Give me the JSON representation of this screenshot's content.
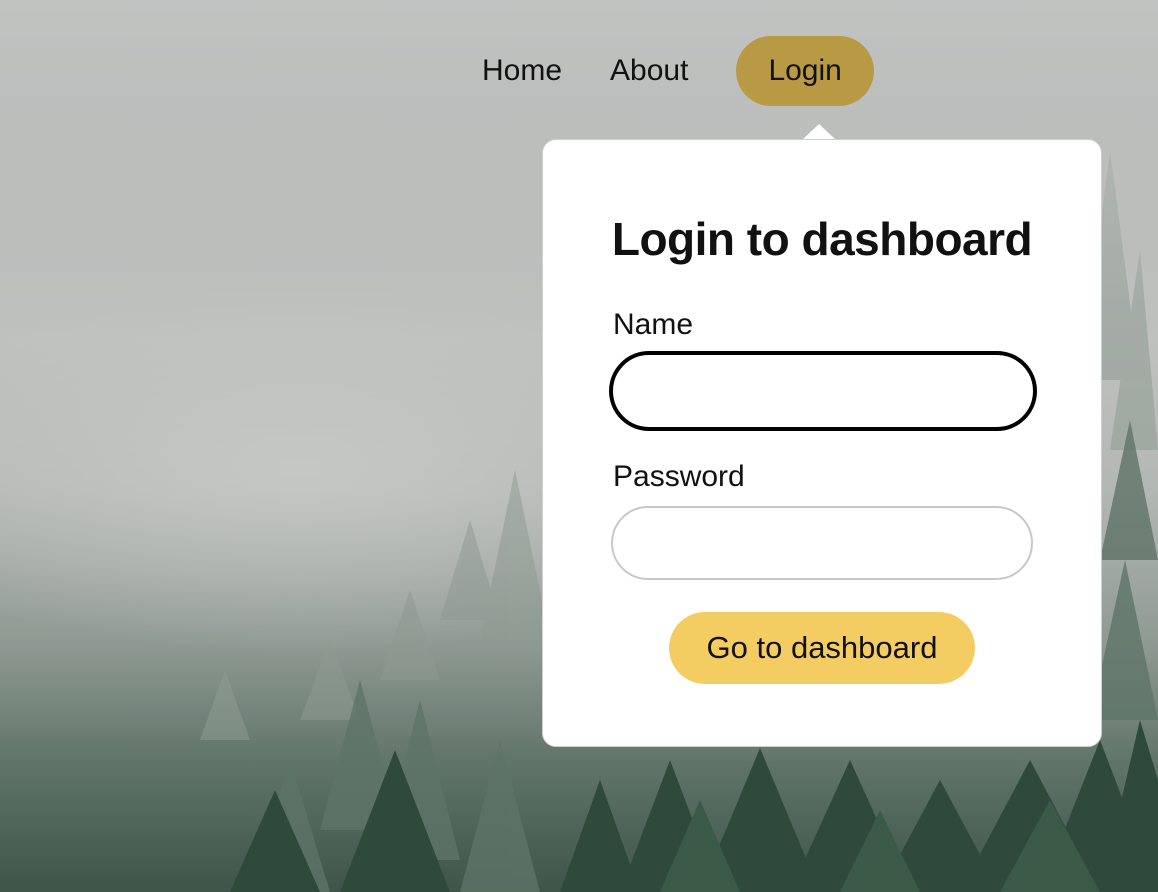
{
  "nav": {
    "home_label": "Home",
    "about_label": "About",
    "login_label": "Login"
  },
  "login_form": {
    "title": "Login to dashboard",
    "name_label": "Name",
    "name_value": "",
    "password_label": "Password",
    "password_value": "",
    "submit_label": "Go to dashboard"
  },
  "colors": {
    "active_nav": "#b89a45",
    "submit_button": "#f3cd62",
    "popover_background": "#ffffff",
    "focused_input_border": "#000000",
    "input_border": "#c8c8c8"
  }
}
